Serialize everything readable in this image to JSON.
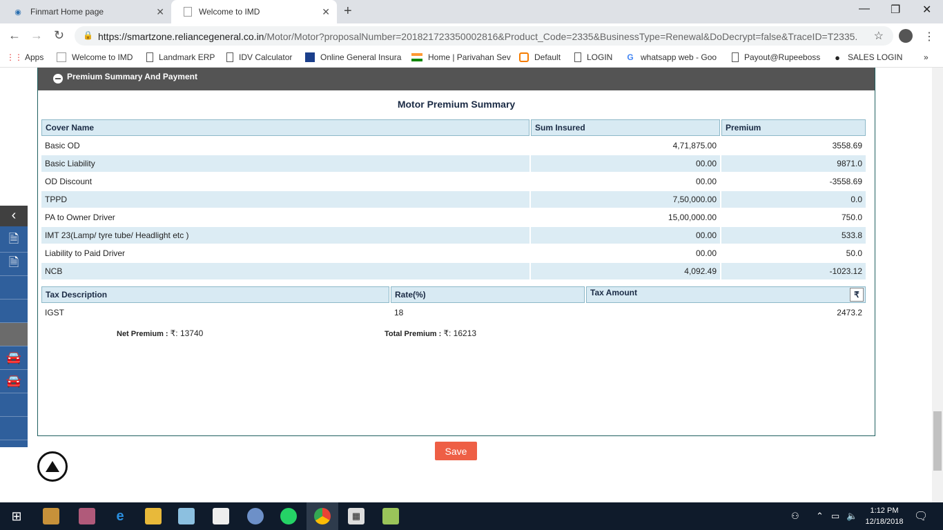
{
  "browser": {
    "tabs": [
      {
        "title": "Finmart Home page",
        "active": false
      },
      {
        "title": "Welcome to IMD",
        "active": true
      }
    ],
    "url_host": "https://smartzone.reliancegeneral.co.in",
    "url_path": "/Motor/Motor?proposalNumber=201821723350002816&Product_Code=2335&BusinessType=Renewal&DoDecrypt=false&TraceID=T2335...",
    "bookmarks": [
      {
        "label": "Apps",
        "icon": "apps-grid-icon"
      },
      {
        "label": "Welcome to IMD",
        "icon": "page-icon"
      },
      {
        "label": "Landmark ERP",
        "icon": "document-icon"
      },
      {
        "label": "IDV Calculator",
        "icon": "document-icon"
      },
      {
        "label": "Online General Insura",
        "icon": "site-logo-icon"
      },
      {
        "label": "Home | Parivahan Sev",
        "icon": "india-flag-icon"
      },
      {
        "label": "Default",
        "icon": "default-site-icon"
      },
      {
        "label": "LOGIN",
        "icon": "document-icon"
      },
      {
        "label": "whatsapp web - Goo",
        "icon": "google-icon"
      },
      {
        "label": "Payout@Rupeeboss",
        "icon": "document-icon"
      },
      {
        "label": "SALES LOGIN",
        "icon": "person-icon"
      }
    ],
    "more_bookmarks": "»"
  },
  "panel": {
    "header": "Premium Summary And Payment",
    "summary_title": "Motor Premium Summary"
  },
  "cover_table": {
    "headers": [
      "Cover Name",
      "Sum Insured",
      "Premium"
    ],
    "rows": [
      {
        "name": "Basic OD",
        "sum": "4,71,875.00",
        "premium": "3558.69"
      },
      {
        "name": "Basic Liability",
        "sum": "00.00",
        "premium": "9871.0"
      },
      {
        "name": "OD Discount",
        "sum": "00.00",
        "premium": "-3558.69"
      },
      {
        "name": "TPPD",
        "sum": "7,50,000.00",
        "premium": "0.0"
      },
      {
        "name": "PA to Owner Driver",
        "sum": "15,00,000.00",
        "premium": "750.0"
      },
      {
        "name": "IMT 23(Lamp/ tyre tube/ Headlight etc )",
        "sum": "00.00",
        "premium": "533.8"
      },
      {
        "name": "Liability to Paid Driver",
        "sum": "00.00",
        "premium": "50.0"
      },
      {
        "name": "NCB",
        "sum": "4,092.49",
        "premium": "-1023.12"
      }
    ]
  },
  "tax_table": {
    "headers": [
      "Tax Description",
      "Rate(%)",
      "Tax Amount"
    ],
    "currency_symbol": "₹",
    "rows": [
      {
        "desc": "IGST",
        "rate": "18",
        "amount": "2473.2"
      }
    ]
  },
  "totals": {
    "net_label": "Net Premium : ",
    "net_value": "₹: 13740",
    "total_label": "Total Premium : ",
    "total_value": "₹: 16213"
  },
  "save_label": "Save",
  "taskbar": {
    "time": "1:12 PM",
    "date": "12/18/2018"
  }
}
